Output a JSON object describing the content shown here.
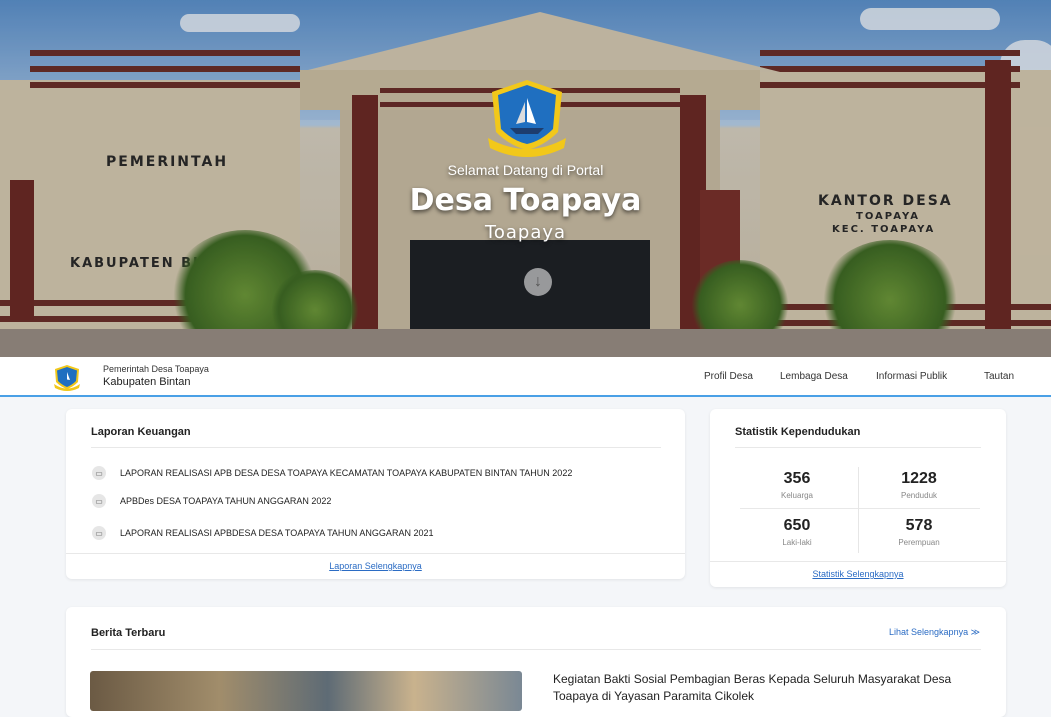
{
  "hero": {
    "welcome": "Selamat Datang di Portal",
    "title": "Desa Toapaya",
    "subtitle": "Toapaya",
    "sign_left_1": "PEMERINTAH",
    "sign_left_2": "KABUPATEN BI",
    "sign_right_1": "KANTOR DESA",
    "sign_right_2": "TOAPAYA",
    "sign_right_3": "KEC. TOAPAYA"
  },
  "nav": {
    "org_line1": "Pemerintah Desa Toapaya",
    "org_line2": "Kabupaten Bintan",
    "menu": [
      "Profil Desa",
      "Lembaga Desa",
      "Informasi Publik",
      "Tautan"
    ]
  },
  "finance": {
    "title": "Laporan Keuangan",
    "items": [
      "LAPORAN REALISASI APB DESA DESA TOAPAYA KECAMATAN TOAPAYA KABUPATEN BINTAN TAHUN 2022",
      "APBDes DESA TOAPAYA TAHUN ANGGARAN 2022",
      "LAPORAN REALISASI APBDESA DESA TOAPAYA TAHUN ANGGARAN 2021"
    ],
    "more": "Laporan Selengkapnya"
  },
  "stats": {
    "title": "Statistik Kependudukan",
    "items": [
      {
        "value": "356",
        "label": "Keluarga"
      },
      {
        "value": "1228",
        "label": "Penduduk"
      },
      {
        "value": "650",
        "label": "Laki-laki"
      },
      {
        "value": "578",
        "label": "Perempuan"
      }
    ],
    "more": "Statistik Selengkapnya"
  },
  "news": {
    "title": "Berita Terbaru",
    "more": "Lihat Selengkapnya ≫",
    "headline": "Kegiatan Bakti Sosial Pembagian Beras Kepada Seluruh Masyarakat Desa Toapaya di Yayasan Paramita Cikolek"
  },
  "colors": {
    "accent": "#4aa0e6",
    "link": "#2b6cc4",
    "brick": "#6b2f2a"
  }
}
